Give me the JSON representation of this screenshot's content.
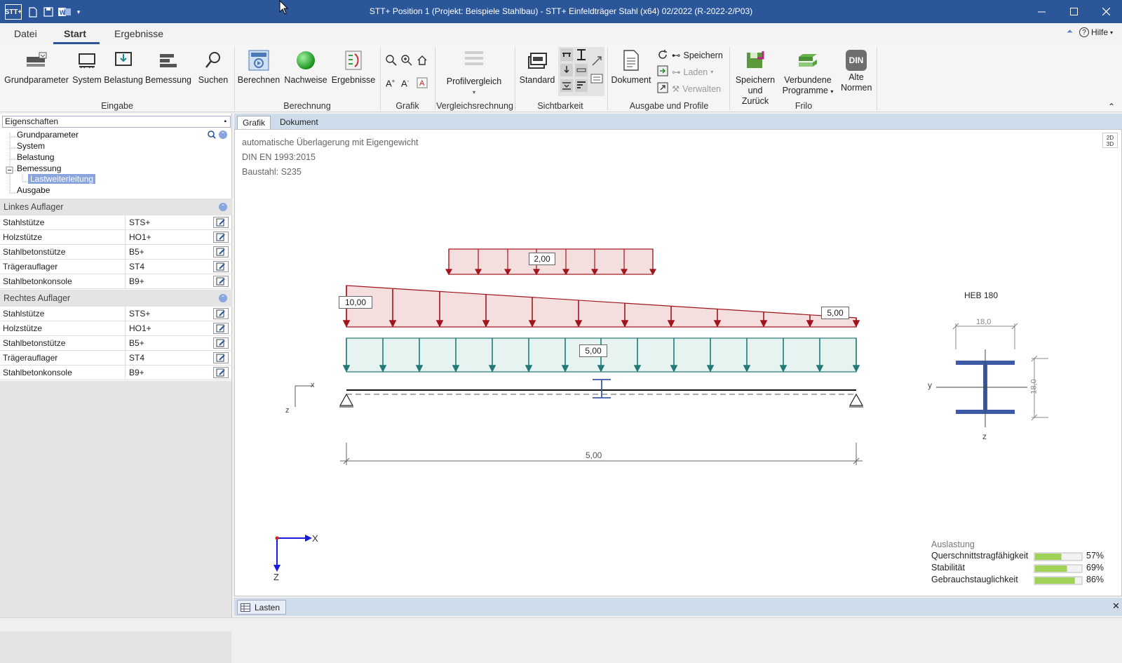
{
  "window": {
    "title": "STT+ Position 1 (Projekt: Beispiele Stahlbau) - STT+ Einfeldträger Stahl (x64) 02/2022 (R-2022-2/P03)",
    "app_icon": "STT+"
  },
  "ribbon_tabs": [
    "Datei",
    "Start",
    "Ergebnisse"
  ],
  "help_label": "Hilfe",
  "ribbon": {
    "eingabe": {
      "group": "Eingabe",
      "buttons": [
        "Grundparameter",
        "System",
        "Belastung",
        "Bemessung",
        "Suchen"
      ]
    },
    "berechnung": {
      "group": "Berechnung",
      "buttons": [
        "Berechnen",
        "Nachweise",
        "Ergebnisse"
      ]
    },
    "grafik": {
      "group": "Grafik"
    },
    "vergleich": {
      "group": "Vergleichsrechnung",
      "button": "Profilvergleich"
    },
    "sichtbarkeit": {
      "group": "Sichtbarkeit",
      "button": "Standard"
    },
    "ausgabe": {
      "group": "Ausgabe und Profile",
      "button": "Dokument",
      "small": [
        "Speichern",
        "Laden",
        "Verwalten"
      ]
    },
    "frilo": {
      "group": "Frilo",
      "buttons": [
        "Speichern und Zurück",
        "Verbundene Programme",
        "Alte Normen"
      ],
      "din_badge": "DIN"
    }
  },
  "left_panel": {
    "title": "Eigenschaften",
    "tree": [
      "Grundparameter",
      "System",
      "Belastung",
      "Bemessung",
      "Lastweiterleitung",
      "Ausgabe"
    ],
    "left_support": {
      "title": "Linkes Auflager",
      "rows": [
        {
          "key": "Stahlstütze",
          "value": "STS+"
        },
        {
          "key": "Holzstütze",
          "value": "HO1+"
        },
        {
          "key": "Stahlbetonstütze",
          "value": "B5+"
        },
        {
          "key": "Trägerauflager",
          "value": "ST4"
        },
        {
          "key": "Stahlbetonkonsole",
          "value": "B9+"
        }
      ]
    },
    "right_support": {
      "title": "Rechtes Auflager",
      "rows": [
        {
          "key": "Stahlstütze",
          "value": "STS+"
        },
        {
          "key": "Holzstütze",
          "value": "HO1+"
        },
        {
          "key": "Stahlbetonstütze",
          "value": "B5+"
        },
        {
          "key": "Trägerauflager",
          "value": "ST4"
        },
        {
          "key": "Stahlbetonkonsole",
          "value": "B9+"
        }
      ]
    }
  },
  "graphic_tabs": [
    "Grafik",
    "Dokument"
  ],
  "graphic": {
    "info": [
      "automatische Überlagerung mit Eigengewicht",
      "DIN EN 1993:2015",
      "Baustahl: S235"
    ],
    "view_toggle": {
      "top": "2D",
      "bottom": "3D"
    },
    "loads": {
      "top": "2,00",
      "trap_left": "10,00",
      "trap_right": "5,00",
      "uniform": "5,00"
    },
    "span": "5,00",
    "axes": {
      "beam_x": "x",
      "beam_z": "z",
      "global_x": "X",
      "global_z": "Z"
    },
    "profile": {
      "name": "HEB 180",
      "width": "18,0",
      "height": "18,0",
      "axis_y": "y",
      "axis_z": "z"
    },
    "auslastung": {
      "title": "Auslastung",
      "items": [
        {
          "label": "Querschnittstragfähigkeit",
          "percent": "57%",
          "value": 57
        },
        {
          "label": "Stabilität",
          "percent": "69%",
          "value": 69
        },
        {
          "label": "Gebrauchstauglichkeit",
          "percent": "86%",
          "value": 86
        }
      ]
    }
  },
  "bottom_tab": "Lasten",
  "colors": {
    "titlebar": "#2b579a",
    "load_red": "#a0151d",
    "load_fill": "#f5dede",
    "load_teal": "#227a78",
    "teal_fill": "#e6f3f1",
    "profile_blue": "#3c5aa8"
  }
}
